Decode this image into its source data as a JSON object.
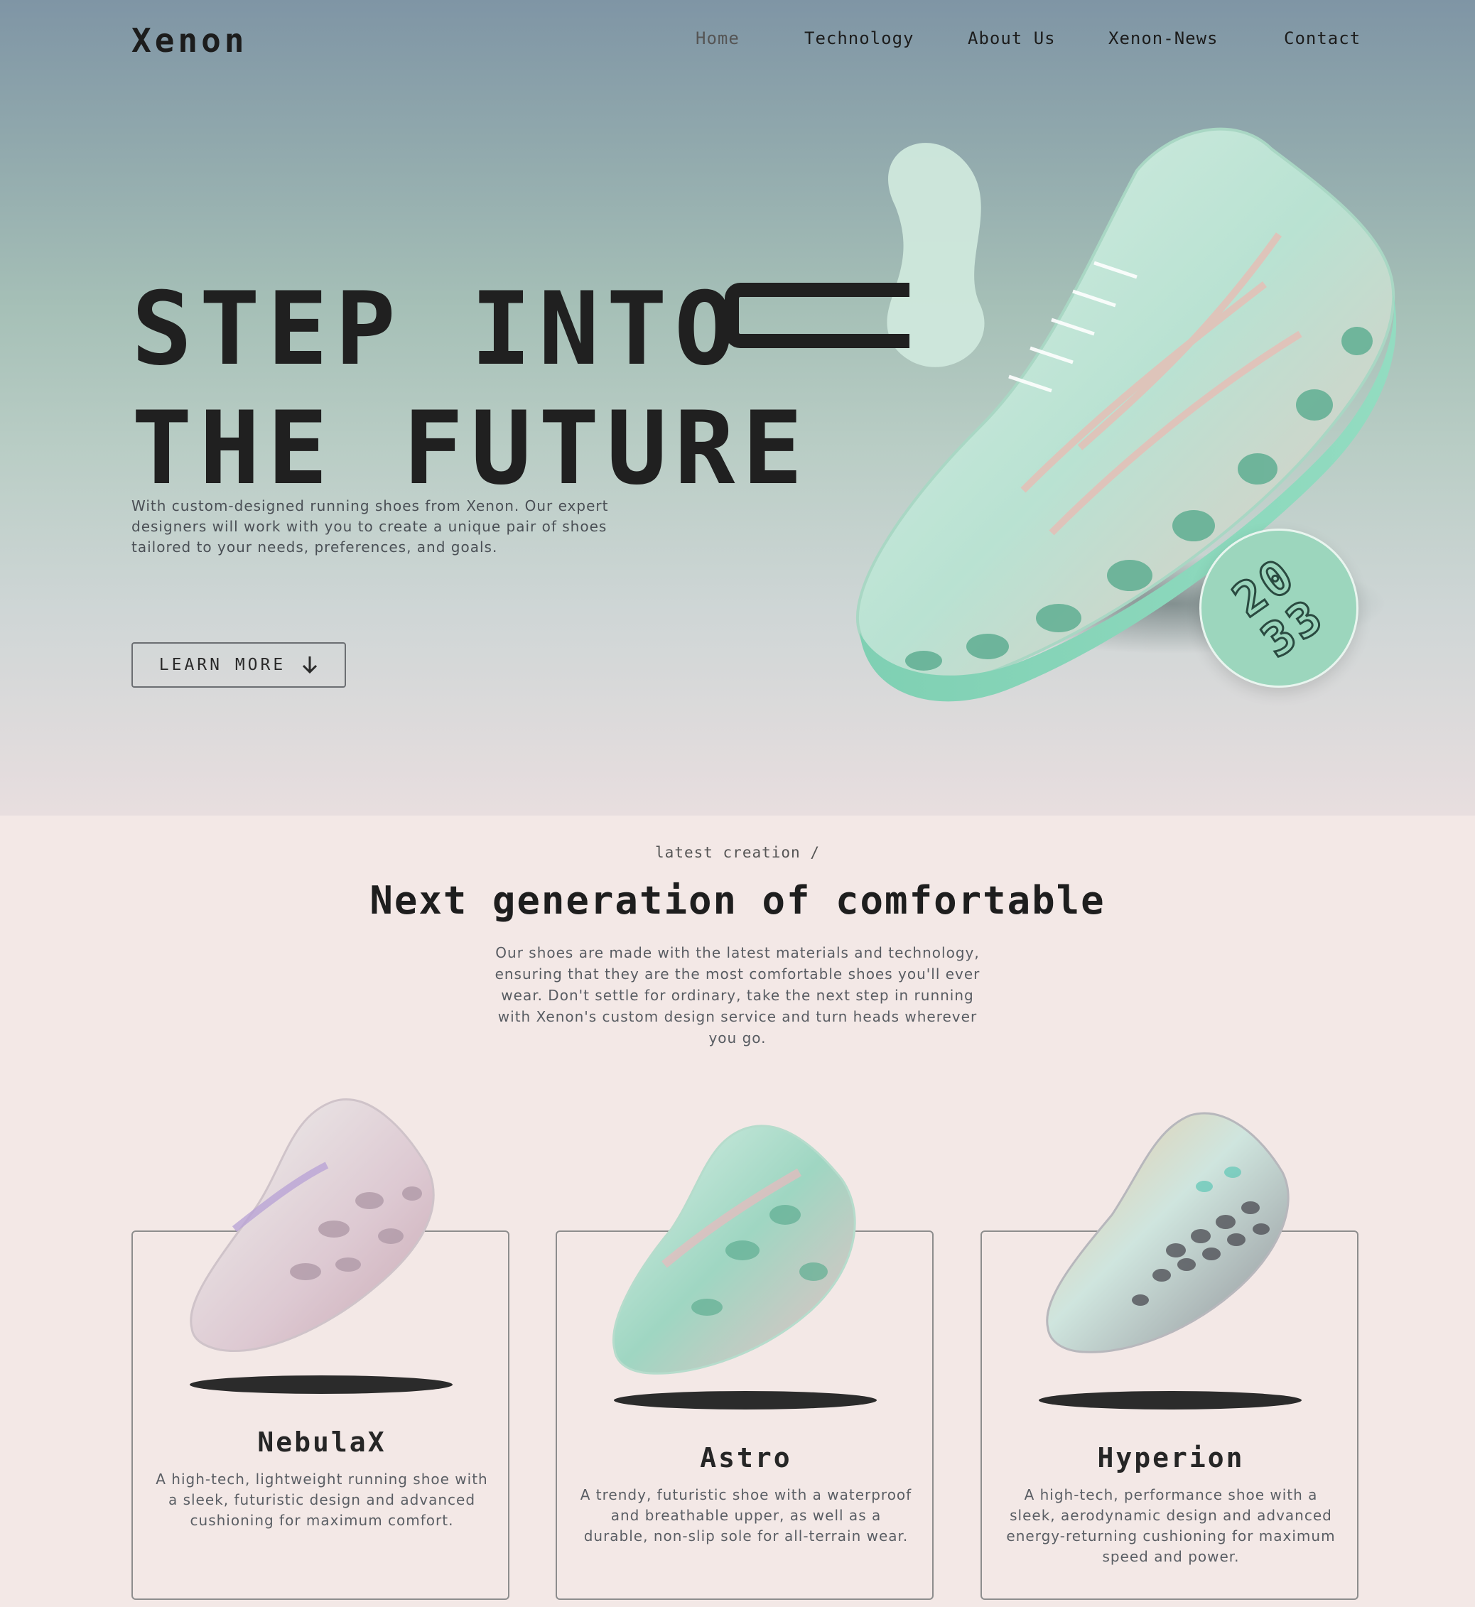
{
  "header": {
    "logo": "Xenon",
    "nav": [
      {
        "label": "Home",
        "active": true
      },
      {
        "label": "Technology",
        "active": false
      },
      {
        "label": "About Us",
        "active": false
      },
      {
        "label": "Xenon-News",
        "active": false
      },
      {
        "label": "Contact",
        "active": false
      }
    ]
  },
  "hero": {
    "title": "STEP INTO\nTHE FUTURE",
    "description": "With custom-designed running shoes from Xenon. Our expert designers will work with you to create a unique pair of shoes tailored to your needs, preferences, and goals.",
    "button_label": "LEARN MORE",
    "button_icon": "arrow-down-icon",
    "badge_text": "2033"
  },
  "latest": {
    "eyebrow": "latest creation /",
    "title": "Next generation of comfortable",
    "description": "Our shoes are made with the latest materials and technology, ensuring that they are the most comfortable shoes you'll ever wear. Don't settle for ordinary, take the next step in running with Xenon's custom design service and turn heads wherever you go.",
    "cards": [
      {
        "name": "NebulaX",
        "description": "A high-tech, lightweight running shoe with a sleek, futuristic design and advanced cushioning for maximum comfort."
      },
      {
        "name": "Astro",
        "description": "A trendy, futuristic shoe with a waterproof and breathable upper, as well as a durable, non-slip sole for all-terrain wear."
      },
      {
        "name": "Hyperion",
        "description": "A high-tech, performance shoe with a sleek, aerodynamic design and advanced energy-returning cushioning for maximum speed and power."
      }
    ]
  },
  "colors": {
    "accent_mint": "#9cd6bd",
    "text_dark": "#1f1f1f",
    "section_bg": "#f3e8e6"
  }
}
